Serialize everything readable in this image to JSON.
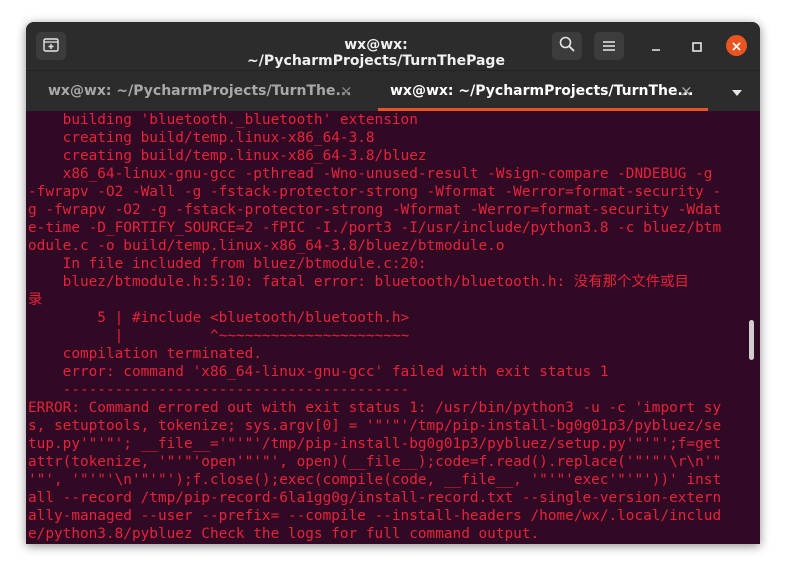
{
  "window": {
    "title": "wx@wx: ~/PycharmProjects/TurnThePage"
  },
  "tabs": [
    {
      "label": "wx@wx: ~/PycharmProjects/TurnThe...",
      "close": "×",
      "active": false
    },
    {
      "label": "wx@wx: ~/PycharmProjects/TurnThe...",
      "close": "×",
      "active": true
    }
  ],
  "icons": {
    "new_tab": "new-tab-icon",
    "search": "search-icon",
    "menu": "hamburger-menu-icon",
    "minimize": "minimize-icon",
    "maximize": "maximize-icon",
    "close": "close-icon",
    "tab_dropdown": "chevron-down-icon"
  },
  "colors": {
    "terminal_bg": "#300a24",
    "terminal_text": "#e8223a",
    "accent": "#e95420",
    "titlebar_bg": "#2c2c2c"
  },
  "terminal": {
    "lines": [
      "    building 'bluetooth._bluetooth' extension",
      "    creating build/temp.linux-x86_64-3.8",
      "    creating build/temp.linux-x86_64-3.8/bluez",
      "    x86_64-linux-gnu-gcc -pthread -Wno-unused-result -Wsign-compare -DNDEBUG -g",
      "-fwrapv -O2 -Wall -g -fstack-protector-strong -Wformat -Werror=format-security -",
      "g -fwrapv -O2 -g -fstack-protector-strong -Wformat -Werror=format-security -Wdat",
      "e-time -D_FORTIFY_SOURCE=2 -fPIC -I./port3 -I/usr/include/python3.8 -c bluez/btm",
      "odule.c -o build/temp.linux-x86_64-3.8/bluez/btmodule.o",
      "    In file included from bluez/btmodule.c:20:",
      "    bluez/btmodule.h:5:10: fatal error: bluetooth/bluetooth.h: 没有那个文件或目",
      "录",
      "        5 | #include <bluetooth/bluetooth.h>",
      "          |          ^~~~~~~~~~~~~~~~~~~~~~~",
      "    compilation terminated.",
      "    error: command 'x86_64-linux-gnu-gcc' failed with exit status 1",
      "    ----------------------------------------",
      "ERROR: Command errored out with exit status 1: /usr/bin/python3 -u -c 'import sy",
      "s, setuptools, tokenize; sys.argv[0] = '\"'\"'/tmp/pip-install-bg0g01p3/pybluez/se",
      "tup.py'\"'\"'; __file__='\"'\"'/tmp/pip-install-bg0g01p3/pybluez/setup.py'\"'\"';f=get",
      "attr(tokenize, '\"'\"'open'\"'\"', open)(__file__);code=f.read().replace('\"'\"'\\r\\n'\"",
      "'\"', '\"'\"'\\n'\"'\"');f.close();exec(compile(code, __file__, '\"'\"'exec'\"'\"'))' inst",
      "all --record /tmp/pip-record-6la1gg0g/install-record.txt --single-version-extern",
      "ally-managed --user --prefix= --compile --install-headers /home/wx/.local/includ",
      "e/python3.8/pybluez Check the logs for full command output."
    ]
  }
}
